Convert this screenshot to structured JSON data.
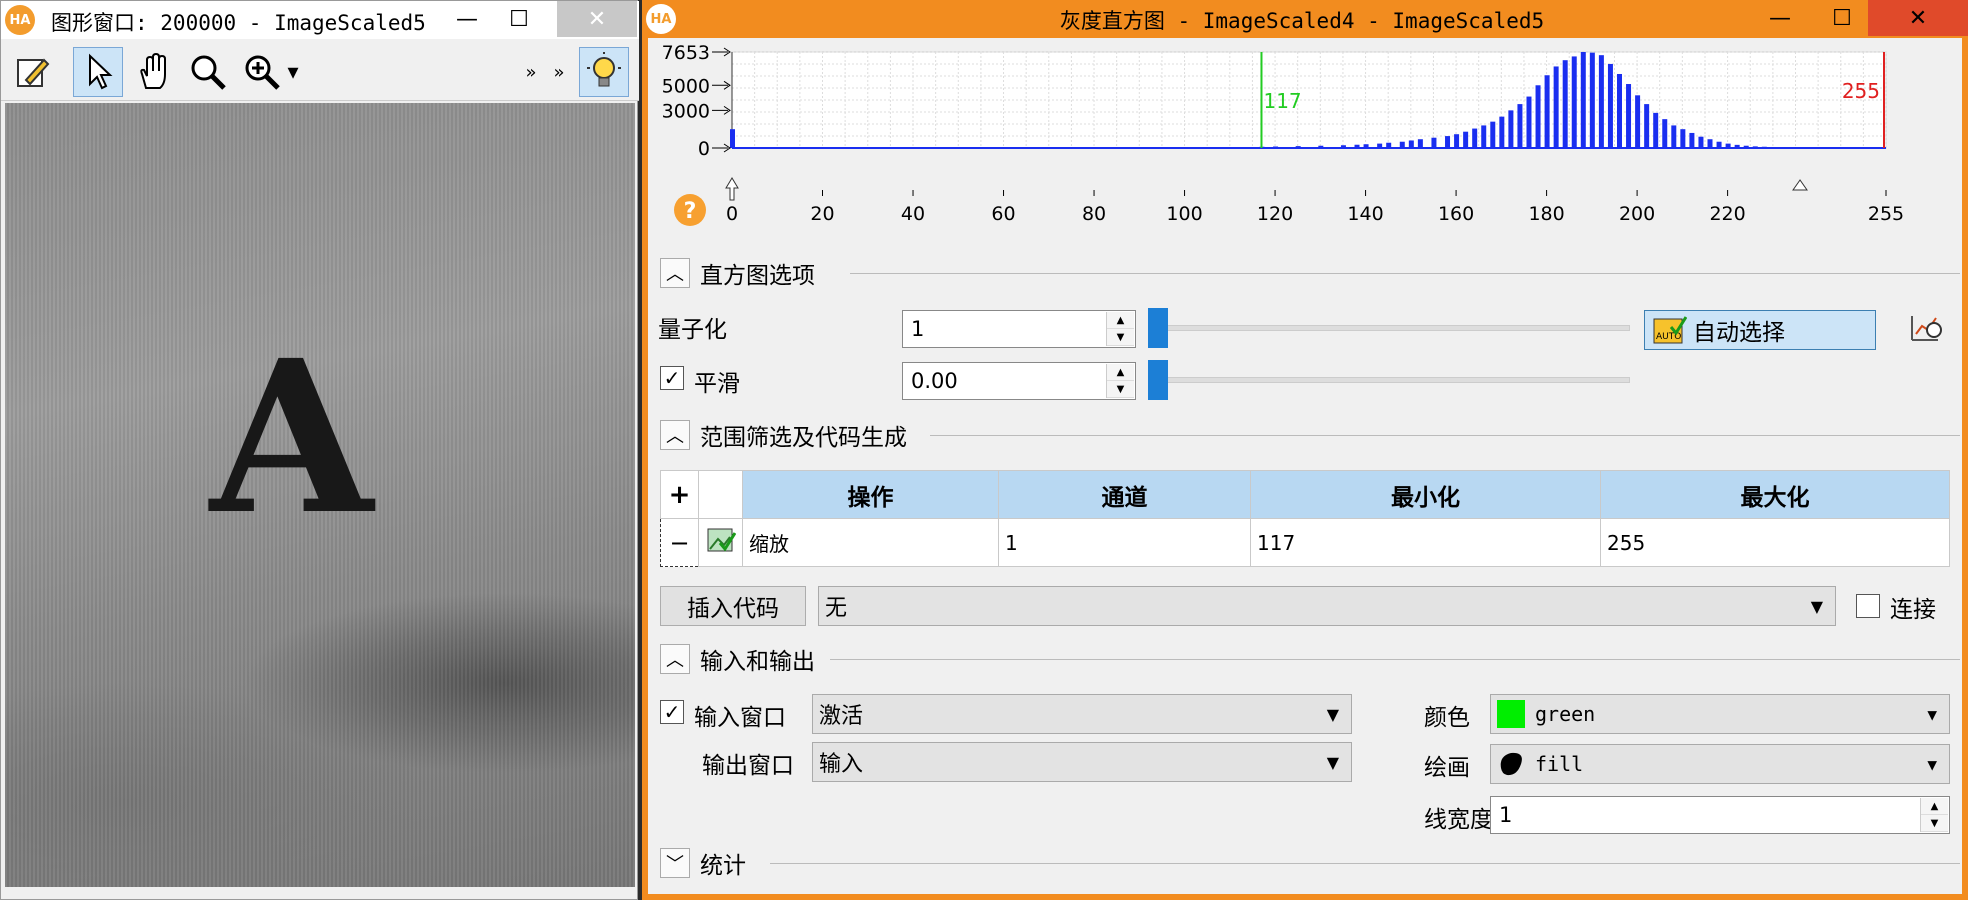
{
  "graphics_window": {
    "title": "图形窗口: 200000 - ImageScaled5",
    "logo": "HA",
    "toolbar_icons": [
      "edit-pen-icon",
      "pointer-icon",
      "hand-pan-icon",
      "zoom-icon",
      "zoom-in-icon",
      "dropdown-arrow-icon",
      "overflow-icon",
      "overflow-icon",
      "lightbulb-icon"
    ],
    "image_letter": "A"
  },
  "histogram_window": {
    "title": "灰度直方图 - ImageScaled4 - ImageScaled5",
    "logo": "HA",
    "plot": {
      "y_ticks": [
        "7653",
        "5000",
        "3000",
        "0"
      ],
      "x_ticks": [
        "0",
        "20",
        "40",
        "60",
        "80",
        "100",
        "120",
        "140",
        "160",
        "180",
        "200",
        "220",
        "255"
      ],
      "min_marker": "117",
      "max_marker": "255",
      "min_color": "#22cc22",
      "max_color": "#e02020",
      "bar_color": "#1a2ef0"
    },
    "sections": {
      "histogram_options": "直方图选项",
      "range_filter": "范围筛选及代码生成",
      "io": "输入和输出",
      "stats": "统计"
    },
    "quantize": {
      "label": "量子化",
      "value": "1",
      "auto_button": "自动选择"
    },
    "smooth": {
      "label": "平滑",
      "value": "0.00",
      "checked": true
    },
    "ops_table": {
      "headers": [
        "操作",
        "通道",
        "最小化",
        "最大化"
      ],
      "add": "+",
      "remove": "−",
      "row": {
        "op": "缩放",
        "channel": "1",
        "min": "117",
        "max": "255"
      }
    },
    "insert_code": {
      "button": "插入代码",
      "value": "无",
      "connect": "连接"
    },
    "io": {
      "input_window_label": "输入窗口",
      "input_window_value": "激活",
      "output_window_label": "输出窗口",
      "output_window_value": "输入",
      "color_label": "颜色",
      "color_value": "green",
      "color_swatch": "#00ee00",
      "draw_label": "绘画",
      "draw_value": "fill",
      "linewidth_label": "线宽度",
      "linewidth_value": "1"
    }
  },
  "chart_data": {
    "type": "bar",
    "title": "",
    "xlabel": "",
    "ylabel": "",
    "xlim": [
      0,
      255
    ],
    "ylim": [
      0,
      7653
    ],
    "bins": [
      0,
      117,
      120,
      125,
      130,
      135,
      138,
      140,
      143,
      145,
      148,
      150,
      152,
      155,
      158,
      160,
      162,
      164,
      166,
      168,
      170,
      172,
      174,
      176,
      178,
      180,
      182,
      184,
      186,
      188,
      190,
      192,
      194,
      196,
      198,
      200,
      202,
      204,
      206,
      208,
      210,
      212,
      214,
      216,
      218,
      220,
      222,
      224,
      226,
      228,
      230,
      232,
      234,
      236
    ],
    "values": [
      1500,
      100,
      120,
      150,
      180,
      220,
      260,
      300,
      350,
      420,
      500,
      600,
      700,
      820,
      950,
      1100,
      1300,
      1550,
      1800,
      2100,
      2500,
      3000,
      3500,
      4100,
      5000,
      5800,
      6500,
      7000,
      7300,
      7653,
      7600,
      7400,
      6700,
      5900,
      5100,
      4200,
      3500,
      2800,
      2300,
      1800,
      1500,
      1200,
      900,
      700,
      500,
      350,
      250,
      180,
      130,
      100,
      80,
      60,
      40,
      20
    ]
  }
}
